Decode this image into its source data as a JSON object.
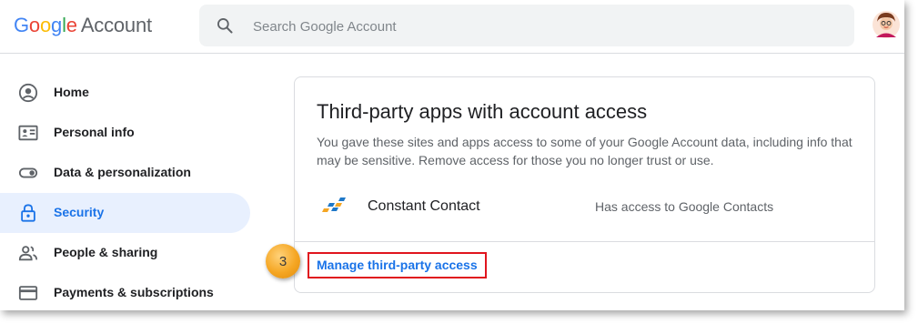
{
  "header": {
    "logo": {
      "letters": [
        {
          "ch": "G",
          "color": "#4285F4"
        },
        {
          "ch": "o",
          "color": "#EA4335"
        },
        {
          "ch": "o",
          "color": "#FBBC05"
        },
        {
          "ch": "g",
          "color": "#4285F4"
        },
        {
          "ch": "l",
          "color": "#34A853"
        },
        {
          "ch": "e",
          "color": "#EA4335"
        }
      ],
      "product": "Account"
    },
    "search": {
      "placeholder": "Search Google Account",
      "value": "",
      "icon": "search-icon"
    },
    "avatar": {
      "icon": "user-avatar"
    }
  },
  "sidebar": {
    "items": [
      {
        "label": "Home",
        "icon": "account-circle-icon",
        "active": false
      },
      {
        "label": "Personal info",
        "icon": "id-card-icon",
        "active": false
      },
      {
        "label": "Data & personalization",
        "icon": "toggle-icon",
        "active": false
      },
      {
        "label": "Security",
        "icon": "lock-icon",
        "active": true
      },
      {
        "label": "People & sharing",
        "icon": "people-icon",
        "active": false
      },
      {
        "label": "Payments & subscriptions",
        "icon": "credit-card-icon",
        "active": false
      }
    ]
  },
  "card": {
    "title": "Third-party apps with account access",
    "description": "You gave these sites and apps access to some of your Google Account data, including info that may be sensitive. Remove access for those you no longer trust or use.",
    "apps": [
      {
        "name": "Constant Contact",
        "access": "Has access to Google Contacts",
        "icon": "constant-contact-logo"
      }
    ],
    "manage_link": "Manage third-party access"
  },
  "annotation": {
    "step": "3",
    "highlight_color": "#e0151e"
  },
  "colors": {
    "accent": "#1a73e8",
    "active_bg": "#e8f0fe",
    "text": "#202124",
    "muted": "#5f6368"
  }
}
